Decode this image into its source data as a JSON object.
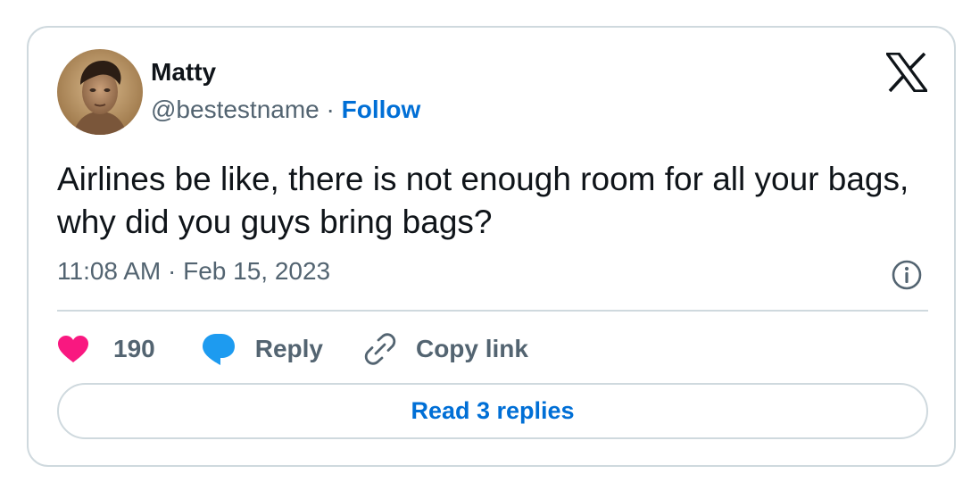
{
  "author": {
    "name": "Matty",
    "handle": "@bestestname",
    "separator": "·",
    "follow_label": "Follow"
  },
  "tweet": {
    "text": "Airlines be like, there is not enough room for all your bags, why did you guys bring bags?",
    "timestamp": "11:08 AM · Feb 15, 2023"
  },
  "actions": {
    "like_count": "190",
    "reply_label": "Reply",
    "copy_link_label": "Copy link"
  },
  "read_replies_label": "Read 3 replies",
  "icons": {
    "brand": "x-logo-icon",
    "info": "info-icon",
    "like": "heart-icon",
    "reply": "speech-bubble-icon",
    "copy": "link-icon"
  },
  "colors": {
    "accent": "#006fd6",
    "text_primary": "#0f1419",
    "text_secondary": "#536471",
    "border": "#cfd9de",
    "heart": "#f91880",
    "reply_bubble": "#1d9bf0"
  }
}
